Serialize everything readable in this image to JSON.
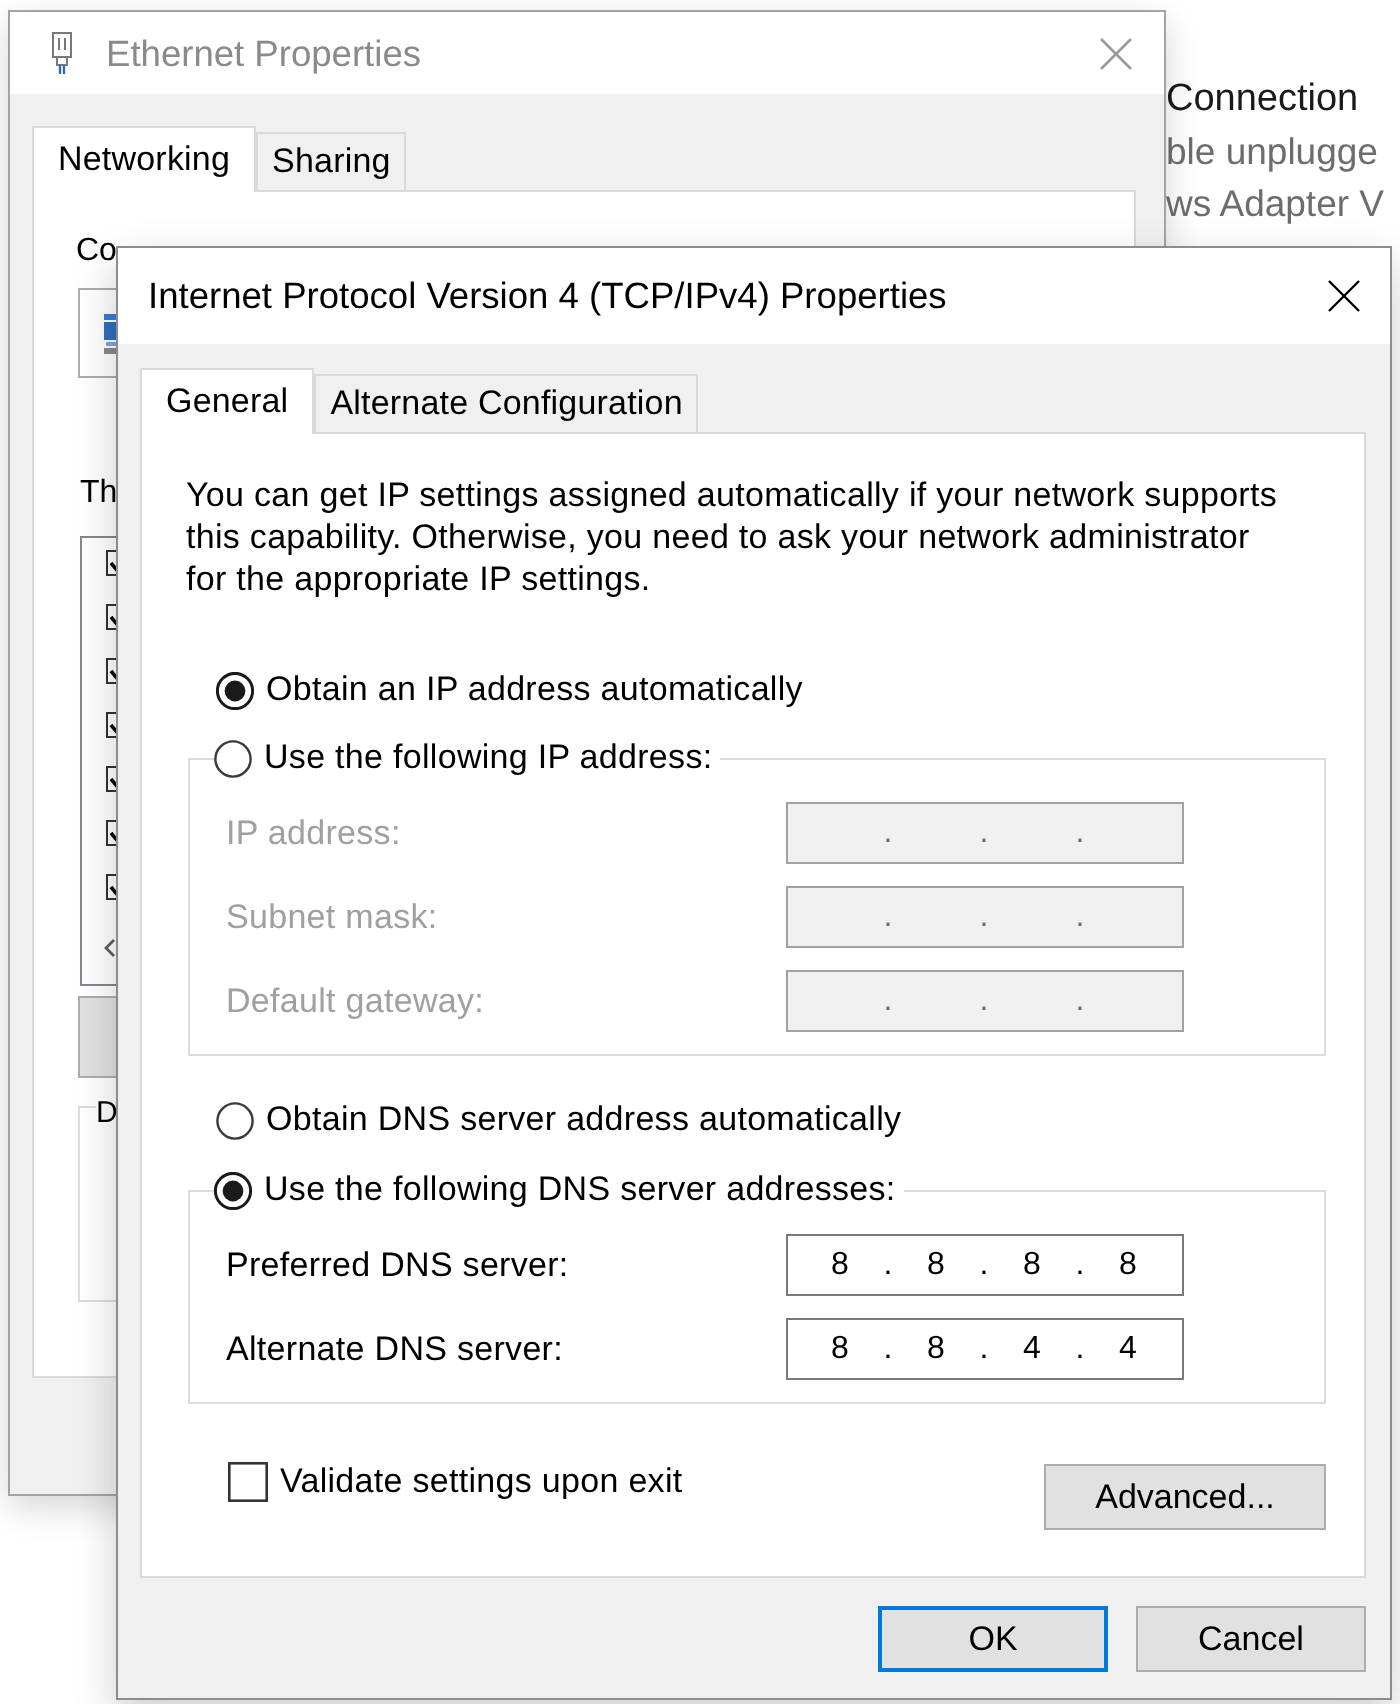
{
  "background_window": {
    "lines": [
      {
        "kind": "heading",
        "text": "Connection"
      },
      {
        "kind": "detail",
        "text": "ble unplugge"
      },
      {
        "kind": "detail",
        "text": "ws Adapter V"
      }
    ]
  },
  "ethernet_dialog": {
    "title": "Ethernet Properties",
    "active": false,
    "tabs": [
      {
        "label": "Networking",
        "selected": true
      },
      {
        "label": "Sharing",
        "selected": false
      }
    ],
    "connect_label": "Co",
    "components_label": "Th",
    "components": [
      {
        "checked": true
      },
      {
        "checked": true
      },
      {
        "checked": true
      },
      {
        "checked": true
      },
      {
        "checked": true
      },
      {
        "checked": true
      },
      {
        "checked": true
      }
    ],
    "group_label": "D"
  },
  "ipv4_dialog": {
    "title": "Internet Protocol Version 4 (TCP/IPv4) Properties",
    "active": true,
    "tabs": [
      {
        "label": "General",
        "selected": true
      },
      {
        "label": "Alternate Configuration",
        "selected": false
      }
    ],
    "description": "You can get IP settings assigned automatically if your network supports this capability. Otherwise, you need to ask your network administrator for the appropriate IP settings.",
    "ip_options": [
      {
        "label": "Obtain an IP address automatically",
        "selected": true
      },
      {
        "label": "Use the following IP address:",
        "selected": false
      }
    ],
    "ip_fields": [
      {
        "label": "IP address:",
        "disabled": true,
        "separators": [
          ".",
          ".",
          "."
        ]
      },
      {
        "label": "Subnet mask:",
        "disabled": true,
        "separators": [
          ".",
          ".",
          "."
        ]
      },
      {
        "label": "Default gateway:",
        "disabled": true,
        "separators": [
          ".",
          ".",
          "."
        ]
      }
    ],
    "dns_options": [
      {
        "label": "Obtain DNS server address automatically",
        "selected": false
      },
      {
        "label": "Use the following DNS server addresses:",
        "selected": true
      }
    ],
    "dns_fields": [
      {
        "label": "Preferred DNS server:",
        "disabled": false,
        "octets": [
          "8",
          "8",
          "8",
          "8"
        ],
        "separators": [
          ".",
          ".",
          "."
        ]
      },
      {
        "label": "Alternate DNS server:",
        "disabled": false,
        "octets": [
          "8",
          "8",
          "4",
          "4"
        ],
        "separators": [
          ".",
          ".",
          "."
        ]
      }
    ],
    "validate": {
      "label": "Validate settings upon exit",
      "checked": false
    },
    "advanced_button": "Advanced...",
    "buttons": [
      {
        "label": "OK",
        "default": true
      },
      {
        "label": "Cancel",
        "default": false
      }
    ]
  }
}
